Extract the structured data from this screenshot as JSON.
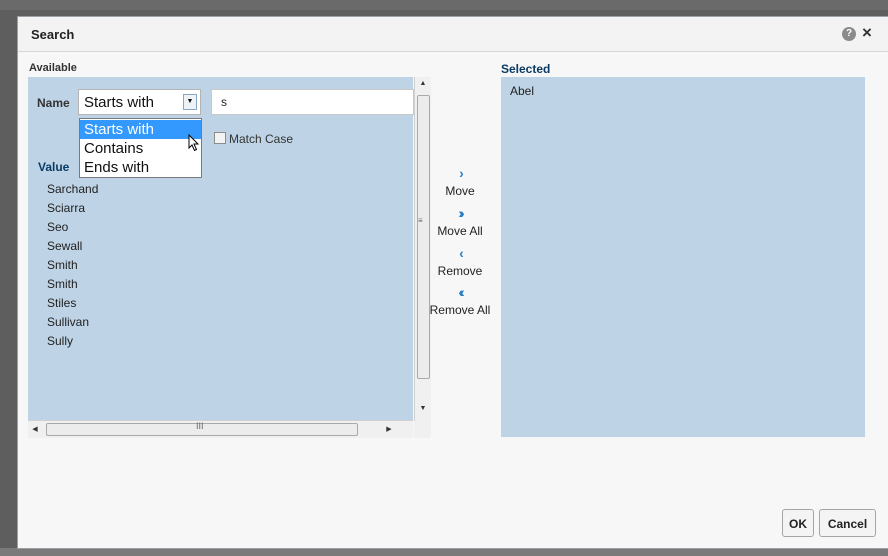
{
  "dialog": {
    "title": "Search"
  },
  "available": {
    "label": "Available",
    "name_label": "Name",
    "operator_selected": "Starts with",
    "operator_options": [
      "Starts with",
      "Contains",
      "Ends with"
    ],
    "search_value": "s",
    "match_case_label": "Match Case",
    "match_case_checked": false,
    "value_header": "Value",
    "values": [
      "Sarchand",
      "Sciarra",
      "Seo",
      "Sewall",
      "Smith",
      "Smith",
      "Stiles",
      "Sullivan",
      "Sully"
    ]
  },
  "shuttle": {
    "move": "Move",
    "move_all": "Move All",
    "remove": "Remove",
    "remove_all": "Remove All"
  },
  "selected": {
    "label": "Selected",
    "items": [
      "Abel"
    ]
  },
  "buttons": {
    "ok": "OK",
    "cancel": "Cancel"
  },
  "colors": {
    "panel": "#bed3e5",
    "header_text": "#0b3b65",
    "highlight": "#3399ff",
    "shuttle_icon": "#2a7dc4"
  },
  "icons": {
    "help": "question-circle-icon",
    "close": "close-icon"
  }
}
